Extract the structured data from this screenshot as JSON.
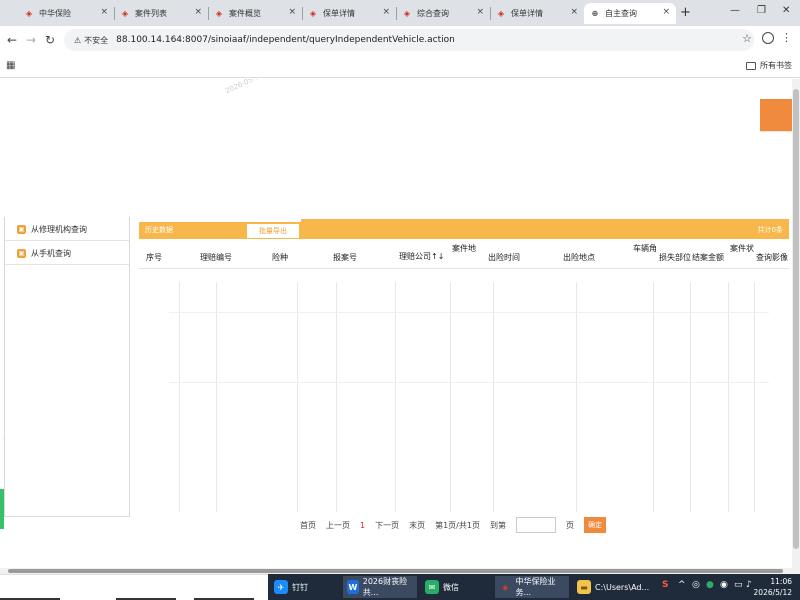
{
  "tabs": [
    {
      "label": "中华保险",
      "close": "×"
    },
    {
      "label": "案件列表",
      "close": "×"
    },
    {
      "label": "案件概览",
      "close": "×"
    },
    {
      "label": "保单详情",
      "close": "×"
    },
    {
      "label": "综合查询",
      "close": "×"
    },
    {
      "label": "保单详情",
      "close": "×"
    },
    {
      "label": "自主查询",
      "close": "×"
    }
  ],
  "address": {
    "insecure_label": "不安全",
    "url": "88.100.14.164:8007/sinoiaaf/independent/queryIndependentVehicle.action"
  },
  "bookmarks": {
    "all_label": "所有书签"
  },
  "sidebar": {
    "items": [
      {
        "label": "从修理机构查询"
      },
      {
        "label": "从手机查询"
      }
    ]
  },
  "panel": {
    "title": "历史数据",
    "export_label": "批量导出",
    "total_label": "共计0条",
    "columns": [
      "序号",
      "理赔编号",
      "险种",
      "报案号",
      "理赔公司↑↓",
      "案件地",
      "出险时间",
      "出险地点",
      "车辆角",
      "损失部位",
      "结案金额",
      "案件状",
      "查询影像"
    ]
  },
  "pager": {
    "first": "首页",
    "prev": "上一页",
    "current": "1",
    "next": "下一页",
    "last": "末页",
    "info": "第1页/共1页",
    "goto": "到第",
    "unit": "页",
    "go": "确定"
  },
  "watermark": "2026-05-12",
  "taskbar": {
    "items": [
      {
        "label": "钉钉"
      },
      {
        "label": "2026财丧险共..."
      },
      {
        "label": "微信"
      },
      {
        "label": "中华保险业务..."
      },
      {
        "label": "C:\\Users\\Ad..."
      }
    ],
    "time": "11:06",
    "date": "2026/5/12"
  },
  "colors": {
    "accent": "#f08a3c",
    "panel_header": "#f7b74a",
    "brand_red": "#d9261c"
  }
}
